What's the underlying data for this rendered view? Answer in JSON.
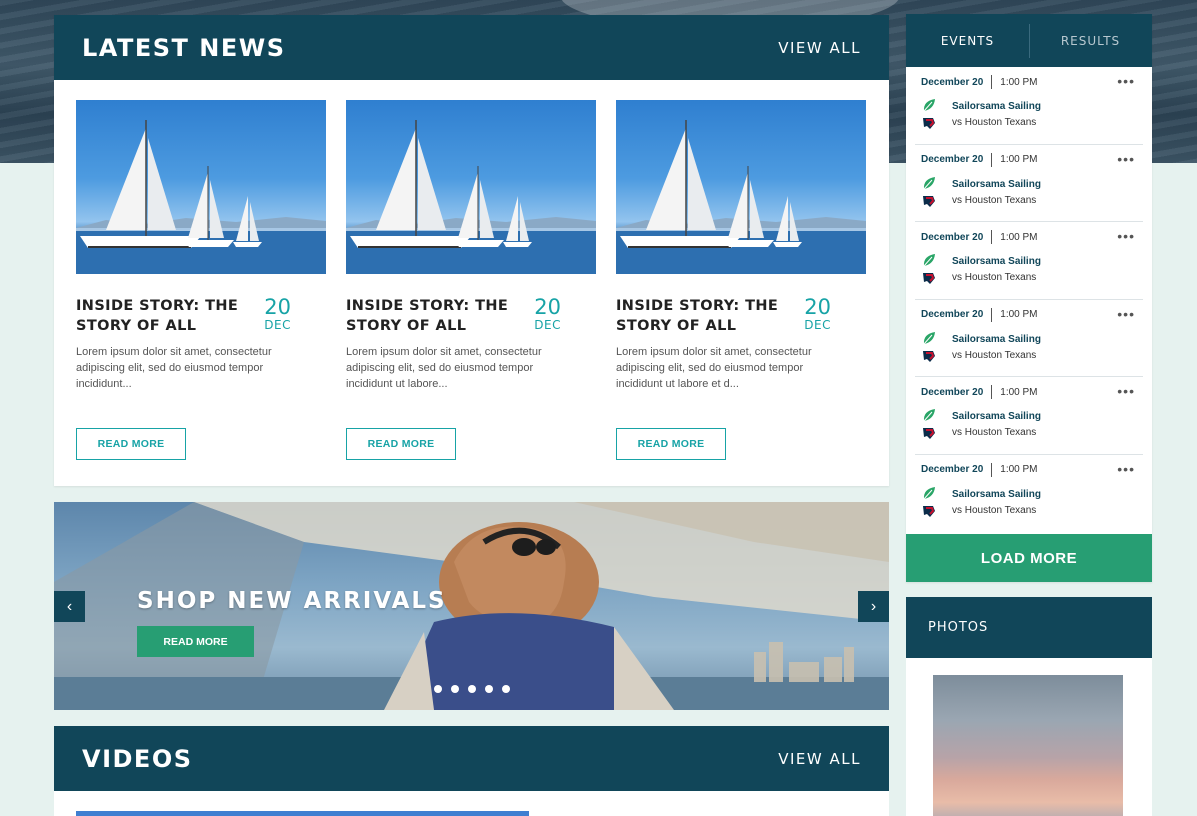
{
  "news": {
    "title": "LATEST NEWS",
    "view_all": "VIEW ALL",
    "articles": [
      {
        "title": "INSIDE STORY: THE STORY OF ALL",
        "day": "20",
        "month": "DEC",
        "excerpt": "Lorem ipsum dolor sit amet, consectetur adipiscing elit, sed do eiusmod tempor incididunt...",
        "button": "READ MORE"
      },
      {
        "title": "INSIDE STORY: THE STORY OF ALL",
        "day": "20",
        "month": "DEC",
        "excerpt": "Lorem ipsum dolor sit amet, consectetur adipiscing elit, sed do eiusmod tempor incididunt ut labore...",
        "button": "READ MORE"
      },
      {
        "title": "INSIDE STORY: THE STORY OF ALL",
        "day": "20",
        "month": "DEC",
        "excerpt": "Lorem ipsum dolor sit amet, consectetur adipiscing elit, sed do eiusmod tempor incididunt ut labore et d...",
        "button": "READ MORE"
      }
    ]
  },
  "promo": {
    "title": "SHOP NEW ARRIVALS",
    "button": "READ MORE",
    "prev_icon": "chevron-left-icon",
    "next_icon": "chevron-right-icon",
    "slide_count": 5
  },
  "videos": {
    "title": "VIDEOS",
    "view_all": "VIEW ALL"
  },
  "events": {
    "tabs": [
      "EVENTS",
      "RESULTS"
    ],
    "items": [
      {
        "date": "December 20",
        "time": "1:00 PM",
        "home": "Sailorsama Sailing",
        "away": "vs Houston Texans"
      },
      {
        "date": "December 20",
        "time": "1:00 PM",
        "home": "Sailorsama Sailing",
        "away": "vs Houston Texans"
      },
      {
        "date": "December 20",
        "time": "1:00 PM",
        "home": "Sailorsama Sailing",
        "away": "vs Houston Texans"
      },
      {
        "date": "December 20",
        "time": "1:00 PM",
        "home": "Sailorsama Sailing",
        "away": "vs Houston Texans"
      },
      {
        "date": "December 20",
        "time": "1:00 PM",
        "home": "Sailorsama Sailing",
        "away": "vs Houston Texans"
      },
      {
        "date": "December 20",
        "time": "1:00 PM",
        "home": "Sailorsama Sailing",
        "away": "vs Houston Texans"
      }
    ],
    "more_icon": "more-dots-icon",
    "load_more": "LOAD MORE"
  },
  "photos": {
    "title": "PHOTOS"
  },
  "colors": {
    "navy": "#114659",
    "teal": "#17a3a6",
    "green": "#279e73",
    "background": "#e6f2ef"
  }
}
